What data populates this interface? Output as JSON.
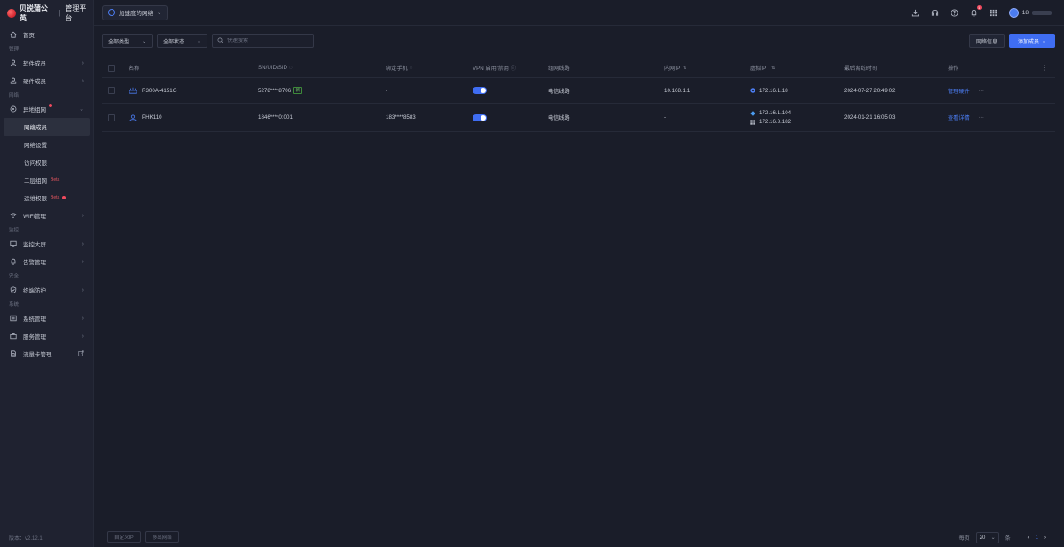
{
  "app": {
    "brand": "贝锐蒲公英",
    "portal": "管理平台",
    "version_label": "版本：v2.12.1"
  },
  "sidebar": {
    "home": "首页",
    "section_manage": "管理",
    "software_members": "软件成员",
    "hardware_members": "硬件成员",
    "section_network": "网络",
    "smart_network": "异地组网",
    "sub_items": [
      {
        "label": "网络成员"
      },
      {
        "label": "网络设置"
      },
      {
        "label": "访问权限"
      },
      {
        "label": "二层组网",
        "tag": "Beta"
      },
      {
        "label": "运维权限",
        "tag": "Beta"
      }
    ],
    "wifi": "WiFi管理",
    "section_monitor": "监控",
    "monitor_screen": "监控大屏",
    "alarm": "告警管理",
    "section_security": "安全",
    "terminal_protect": "终端防护",
    "section_system": "系统",
    "system_manage": "系统管理",
    "service_manage": "服务管理",
    "traffic_card": "流量卡管理"
  },
  "topbar": {
    "network_name": "加速度的网络",
    "notification_count": "1",
    "username": "18"
  },
  "filters": {
    "type": "全部类型",
    "status": "全部状态",
    "search_placeholder": "快速搜索",
    "network_info": "网络信息",
    "add_member": "添加成员"
  },
  "table": {
    "headers": {
      "name": "名称",
      "sn": "SN/UID/SID",
      "phone": "绑定手机",
      "vpn": "VPN 启用/禁用",
      "line": "组网线路",
      "lan_ip": "内网IP",
      "virtual_ip": "虚拟IP",
      "last_online": "最后离线时间",
      "ops": "操作"
    },
    "rows": [
      {
        "name": "R300A-4151G",
        "sn": "5278****8706",
        "sn_tag": "新",
        "phone": "-",
        "vpn_on": true,
        "line": "电信线路",
        "lan_ip": "10.168.1.1",
        "virtual_ip": [
          "172.16.1.18"
        ],
        "last_online": "2024-07-27 20:49:02",
        "op_label": "管理硬件",
        "more": "···"
      },
      {
        "name": "PHK110",
        "sn": "1846****0:001",
        "phone": "183****8583",
        "vpn_on": true,
        "line": "电信线路",
        "lan_ip": "-",
        "virtual_ip": [
          "172.16.1.104",
          "172.16.3.182"
        ],
        "last_online": "2024-01-21 16:05:03",
        "op_label": "查看详情",
        "more": "···"
      }
    ]
  },
  "footer": {
    "btn_custom_ip": "自定义IP",
    "btn_remove": "移出网络",
    "per_page": "每页",
    "page_size": "20",
    "unit": "条",
    "current_page": "1"
  },
  "colors": {
    "accent": "#3f6df2",
    "background": "#1a1d29",
    "sidebar": "#1f2230",
    "danger": "#f04a5e"
  }
}
